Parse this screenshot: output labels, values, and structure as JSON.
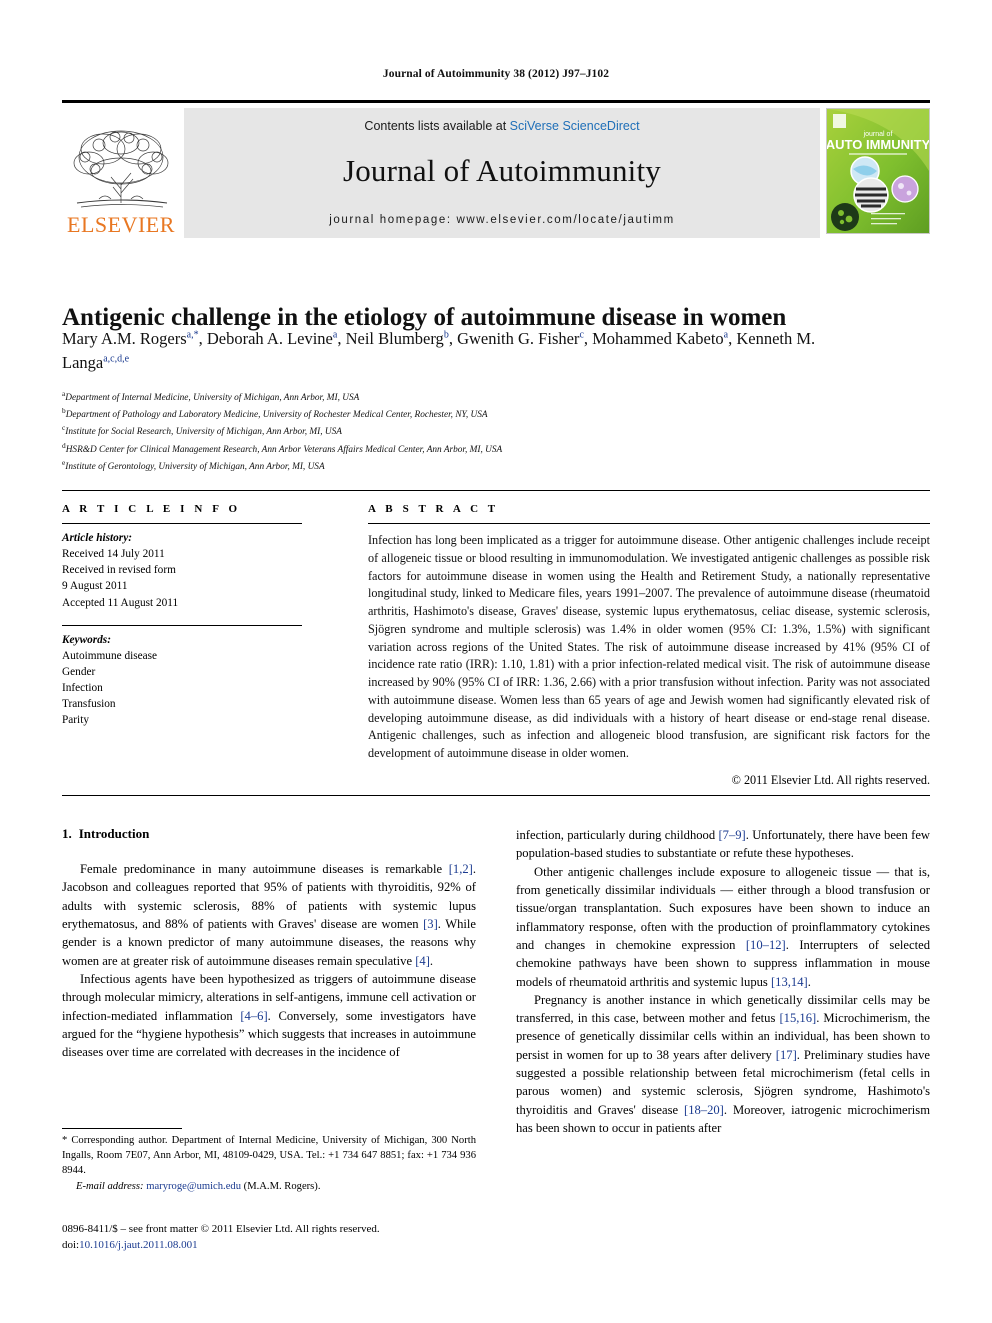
{
  "running_head": "Journal of Autoimmunity 38 (2012) J97–J102",
  "masthead": {
    "contents_prefix": "Contents lists available at ",
    "sciencedirect": "SciVerse ScienceDirect",
    "journal_title": "Journal of Autoimmunity",
    "homepage": "journal homepage: www.elsevier.com/locate/jautimm",
    "publisher_logo_text": "ELSEVIER",
    "cover": {
      "kicker": "journal of",
      "title_line1": "AUTO",
      "title_line2": "IMMUNITY",
      "accent_color": "#8dc63f"
    }
  },
  "article": {
    "title": "Antigenic challenge in the etiology of autoimmune disease in women",
    "authors": [
      {
        "name": "Mary A.M. Rogers",
        "sup": "a,*"
      },
      {
        "name": "Deborah A. Levine",
        "sup": "a"
      },
      {
        "name": "Neil Blumberg",
        "sup": "b"
      },
      {
        "name": "Gwenith G. Fisher",
        "sup": "c"
      },
      {
        "name": "Mohammed Kabeto",
        "sup": "a"
      },
      {
        "name": "Kenneth M. Langa",
        "sup": "a,c,d,e"
      }
    ],
    "affiliations": [
      {
        "mark": "a",
        "text": "Department of Internal Medicine, University of Michigan, Ann Arbor, MI, USA"
      },
      {
        "mark": "b",
        "text": "Department of Pathology and Laboratory Medicine, University of Rochester Medical Center, Rochester, NY, USA"
      },
      {
        "mark": "c",
        "text": "Institute for Social Research, University of Michigan, Ann Arbor, MI, USA"
      },
      {
        "mark": "d",
        "text": "HSR&D Center for Clinical Management Research, Ann Arbor Veterans Affairs Medical Center, Ann Arbor, MI, USA"
      },
      {
        "mark": "e",
        "text": "Institute of Gerontology, University of Michigan, Ann Arbor, MI, USA"
      }
    ]
  },
  "article_info": {
    "heading": "A R T I C L E   I N F O",
    "history_label": "Article history:",
    "history": [
      "Received 14 July 2011",
      "Received in revised form",
      "9 August 2011",
      "Accepted 11 August 2011"
    ],
    "keywords_label": "Keywords:",
    "keywords": [
      "Autoimmune disease",
      "Gender",
      "Infection",
      "Transfusion",
      "Parity"
    ]
  },
  "abstract": {
    "heading": "A B S T R A C T",
    "text": "Infection has long been implicated as a trigger for autoimmune disease. Other antigenic challenges include receipt of allogeneic tissue or blood resulting in immunomodulation. We investigated antigenic challenges as possible risk factors for autoimmune disease in women using the Health and Retirement Study, a nationally representative longitudinal study, linked to Medicare files, years 1991–2007. The prevalence of autoimmune disease (rheumatoid arthritis, Hashimoto's disease, Graves' disease, systemic lupus erythematosus, celiac disease, systemic sclerosis, Sjögren syndrome and multiple sclerosis) was 1.4% in older women (95% CI: 1.3%, 1.5%) with significant variation across regions of the United States. The risk of autoimmune disease increased by 41% (95% CI of incidence rate ratio (IRR): 1.10, 1.81) with a prior infection-related medical visit. The risk of autoimmune disease increased by 90% (95% CI of IRR: 1.36, 2.66) with a prior transfusion without infection. Parity was not associated with autoimmune disease. Women less than 65 years of age and Jewish women had significantly elevated risk of developing autoimmune disease, as did individuals with a history of heart disease or end-stage renal disease. Antigenic challenges, such as infection and allogeneic blood transfusion, are significant risk factors for the development of autoimmune disease in older women.",
    "copyright": "© 2011 Elsevier Ltd. All rights reserved."
  },
  "body": {
    "section_number": "1.",
    "section_title": "Introduction",
    "left_paragraphs": [
      "Female predominance in many autoimmune diseases is remarkable [1,2]. Jacobson and colleagues reported that 95% of patients with thyroiditis, 92% of adults with systemic sclerosis, 88% of patients with systemic lupus erythematosus, and 88% of patients with Graves' disease are women [3]. While gender is a known predictor of many autoimmune diseases, the reasons why women are at greater risk of autoimmune diseases remain speculative [4].",
      "Infectious agents have been hypothesized as triggers of autoimmune disease through molecular mimicry, alterations in self-antigens, immune cell activation or infection-mediated inflammation [4–6]. Conversely, some investigators have argued for the “hygiene hypothesis” which suggests that increases in autoimmune diseases over time are correlated with decreases in the incidence of"
    ],
    "right_paragraphs": [
      "infection, particularly during childhood [7–9]. Unfortunately, there have been few population-based studies to substantiate or refute these hypotheses.",
      "Other antigenic challenges include exposure to allogeneic tissue — that is, from genetically dissimilar individuals — either through a blood transfusion or tissue/organ transplantation. Such exposures have been shown to induce an inflammatory response, often with the production of proinflammatory cytokines and changes in chemokine expression [10–12]. Interrupters of selected chemokine pathways have been shown to suppress inflammation in mouse models of rheumatoid arthritis and systemic lupus [13,14].",
      "Pregnancy is another instance in which genetically dissimilar cells may be transferred, in this case, between mother and fetus [15,16]. Microchimerism, the presence of genetically dissimilar cells within an individual, has been shown to persist in women for up to 38 years after delivery [17]. Preliminary studies have suggested a possible relationship between fetal microchimerism (fetal cells in parous women) and systemic sclerosis, Sjögren syndrome, Hashimoto's thyroiditis and Graves' disease [18–20]. Moreover, iatrogenic microchimerism has been shown to occur in patients after"
    ]
  },
  "footnote": {
    "corresponding": "* Corresponding author. Department of Internal Medicine, University of Michigan, 300 North Ingalls, Room 7E07, Ann Arbor, MI, 48109-0429, USA. Tel.: +1 734 647 8851; fax: +1 734 936 8944.",
    "email_label": "E-mail address:",
    "email": "maryroge@umich.edu",
    "email_owner": "(M.A.M. Rogers)."
  },
  "imprint": {
    "line1": "0896-8411/$ – see front matter © 2011 Elsevier Ltd. All rights reserved.",
    "doi_label": "doi:",
    "doi": "10.1016/j.jaut.2011.08.001"
  }
}
